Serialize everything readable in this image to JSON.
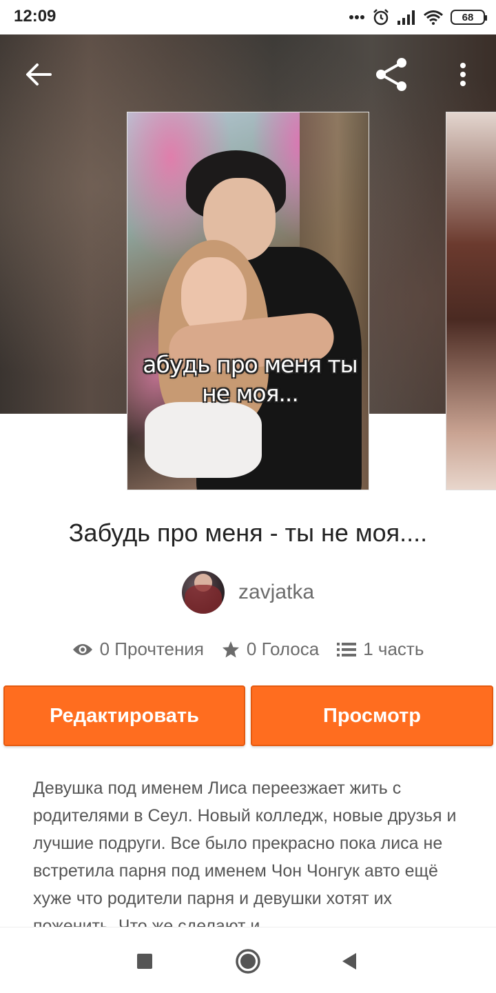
{
  "status_bar": {
    "time": "12:09",
    "battery": "68",
    "icons": [
      "more-dots-icon",
      "alarm-icon",
      "signal-icon",
      "wifi-icon",
      "battery-icon"
    ]
  },
  "top_bar": {
    "back_icon": "arrow-left-icon",
    "share_icon": "share-icon",
    "menu_icon": "more-vert-icon"
  },
  "cover": {
    "title_line1": "абудь про меня ты",
    "title_line2": "не моя..."
  },
  "story": {
    "title": "Забудь про меня - ты не моя....",
    "author": "zavjatka"
  },
  "stats": {
    "reads": "0 Прочтения",
    "votes": "0 Голоса",
    "parts": "1 часть"
  },
  "buttons": {
    "edit": "Редактировать",
    "view": "Просмотр"
  },
  "description": "Девушка под именем Лиса переезжает жить с родителями в Сеул. Новый колледж, новые друзья и лучшие подруги. Все было прекрасно пока лиса не встретила парня под именем Чон Чонгук авто ещё хуже что родители парня и девушки хотят их поженить. Что же сделают и",
  "colors": {
    "accent": "#ff6d1f",
    "text_primary": "#222222",
    "text_secondary": "#6b6b6b"
  },
  "nav_bar": {
    "icons": [
      "recents-square-icon",
      "home-circle-icon",
      "back-triangle-icon"
    ]
  }
}
